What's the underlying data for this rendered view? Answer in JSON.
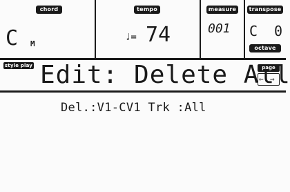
{
  "header": {
    "chord": {
      "label": "chord",
      "root": "C",
      "type": "M"
    },
    "tempo": {
      "label": "tempo",
      "note": "♩=",
      "value": "74"
    },
    "measure": {
      "label": "measure",
      "value": "001"
    },
    "transpose": {
      "label": "transpose",
      "value": "C",
      "value2": "0",
      "octave_label": "octave"
    }
  },
  "title": {
    "mode_badge": "style play",
    "text": "Edit: Delete All"
  },
  "page": {
    "label": "page",
    "prev": "⇐",
    "next": "⇒"
  },
  "parameters": {
    "line": "Del.:V1-CV1 Trk :All"
  }
}
